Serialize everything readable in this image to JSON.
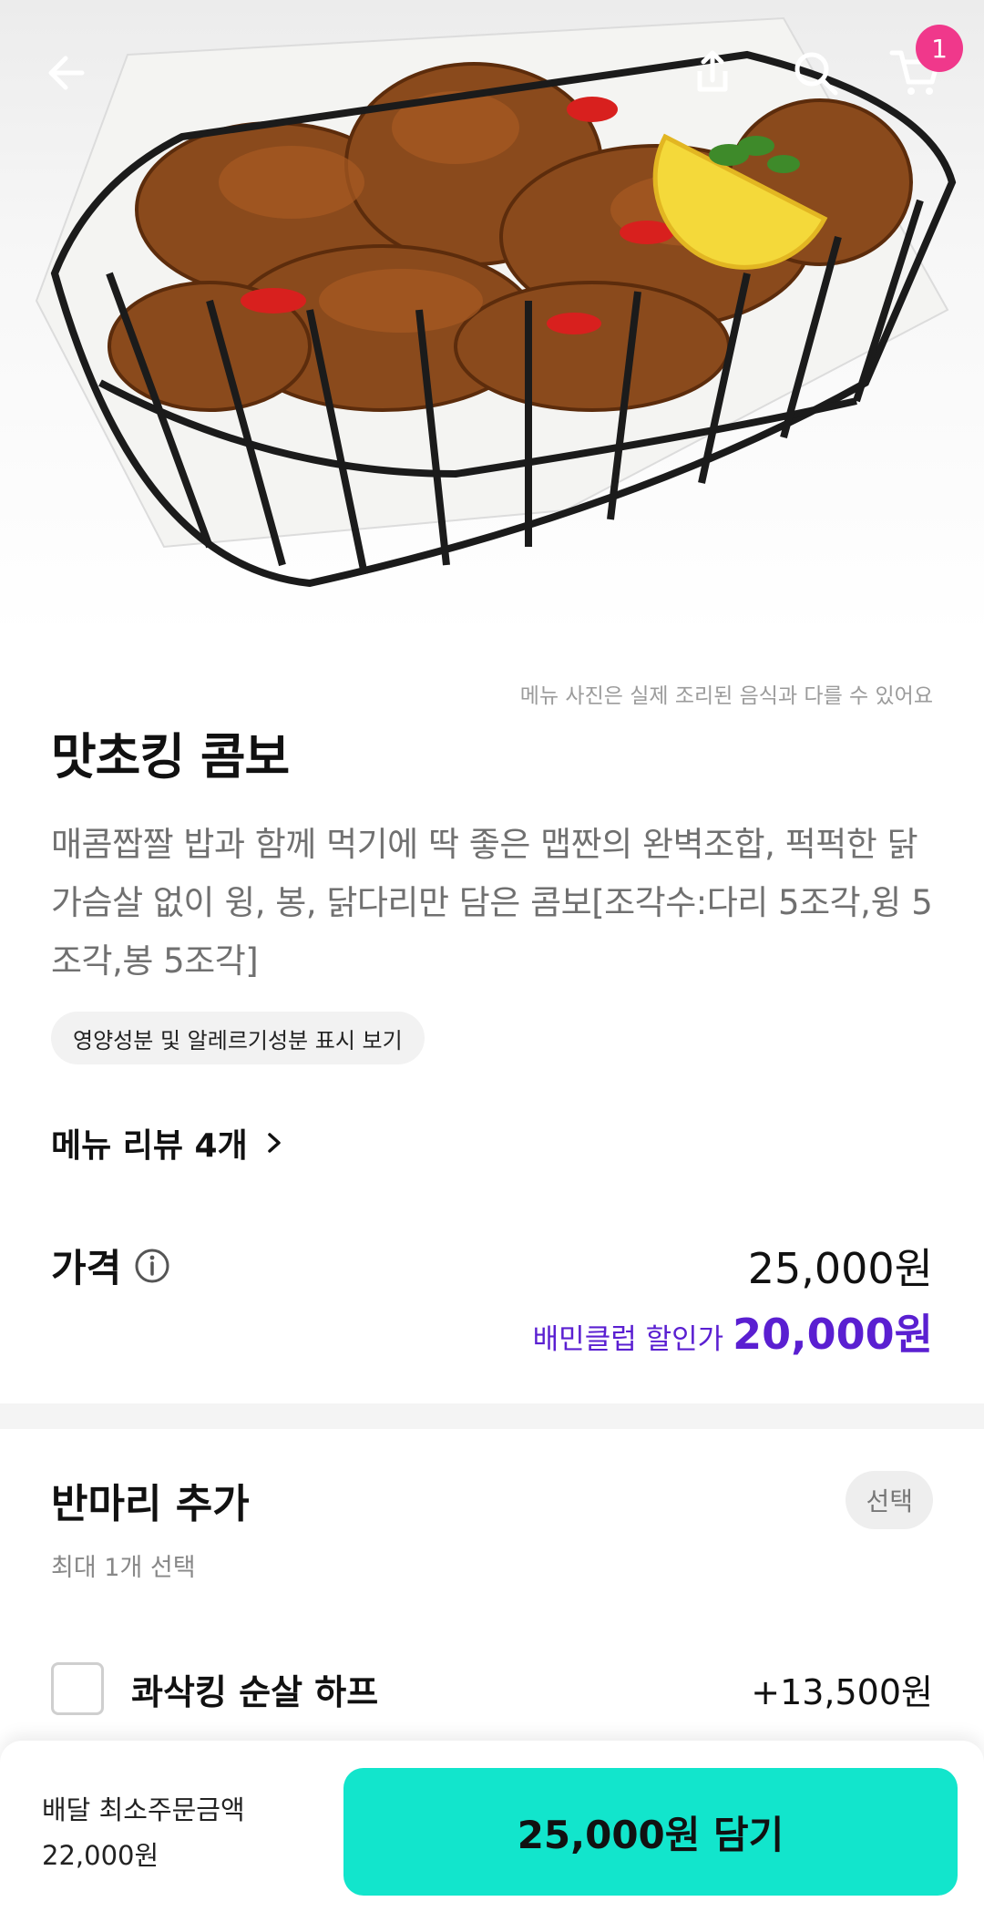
{
  "header": {
    "back_icon": "arrow-left-icon",
    "share_icon": "share-icon",
    "search_icon": "search-icon",
    "cart_icon": "cart-icon",
    "cart_count": "1"
  },
  "hero": {
    "image_alt_icon": "fried-chicken-basket-image"
  },
  "menu": {
    "disclaimer": "메뉴 사진은 실제 조리된 음식과 다를 수 있어요",
    "title": "맛초킹 콤보",
    "description": "매콤짭짤 밥과 함께 먹기에 딱 좋은 맵짠의 완벽조합, 퍽퍽한 닭가슴살 없이 윙, 봉, 닭다리만 담은 콤보[조각수:다리 5조각,윙 5조각,봉 5조각]",
    "nutrition_button": "영양성분 및 알레르기성분 표시 보기",
    "reviews_link": "메뉴 리뷰 4개"
  },
  "price": {
    "label": "가격",
    "value": "25,000원",
    "club_label": "배민클럽 할인가",
    "club_value": "20,000원",
    "club_color": "#5a1fd1"
  },
  "option_group": {
    "title": "반마리 추가",
    "tag": "선택",
    "subtitle": "최대 1개 선택",
    "items": [
      {
        "name": "콰삭킹 순살 하프",
        "price": "+13,500원",
        "checked": false
      }
    ]
  },
  "bottom_bar": {
    "min_order_label": "배달 최소주문금액",
    "min_order_value": "22,000원",
    "cta_label": "25,000원 담기",
    "cta_color": "#12e5cc"
  }
}
